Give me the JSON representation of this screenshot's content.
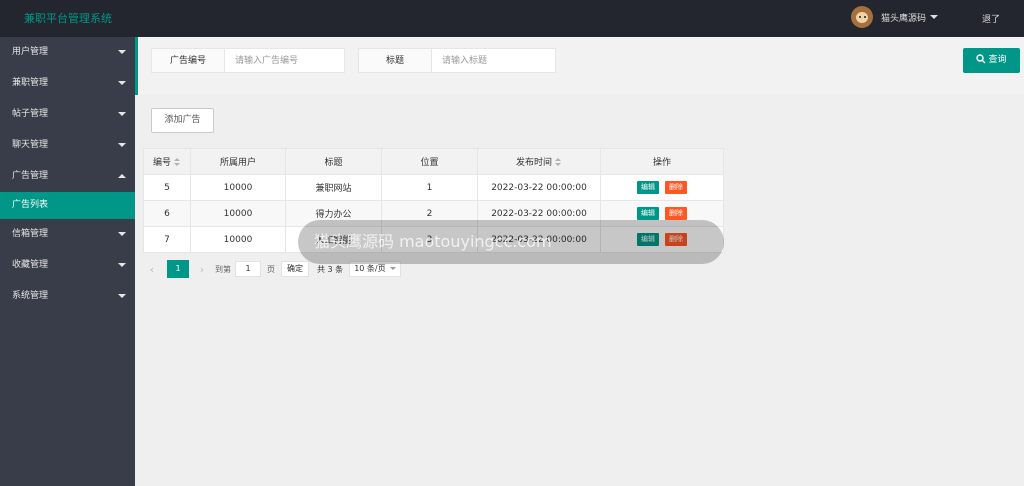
{
  "header": {
    "app_title": "兼职平台管理系统",
    "username": "猫头鹰源码",
    "logout": "退了"
  },
  "sidebar": {
    "items": [
      {
        "label": "用户管理",
        "expanded": false
      },
      {
        "label": "兼职管理",
        "expanded": false
      },
      {
        "label": "帖子管理",
        "expanded": false
      },
      {
        "label": "聊天管理",
        "expanded": false
      },
      {
        "label": "广告管理",
        "expanded": true,
        "sub": "广告列表"
      },
      {
        "label": "信箱管理",
        "expanded": false
      },
      {
        "label": "收藏管理",
        "expanded": false
      },
      {
        "label": "系统管理",
        "expanded": false
      }
    ]
  },
  "search": {
    "ad_id_label": "广告编号",
    "ad_id_placeholder": "请输入广告编号",
    "title_label": "标题",
    "title_placeholder": "请输入标题",
    "query_label": "查询"
  },
  "toolbar": {
    "add_label": "添加广告"
  },
  "table": {
    "headers": [
      "编号",
      "所属用户",
      "标题",
      "位置",
      "发布时间",
      "操作"
    ],
    "rows": [
      {
        "id": "5",
        "user": "10000",
        "title": "兼职网站",
        "position": "1",
        "time": "2022-03-22 00:00:00"
      },
      {
        "id": "6",
        "user": "10000",
        "title": "得力办公",
        "position": "2",
        "time": "2022-03-22 00:00:00"
      },
      {
        "id": "7",
        "user": "10000",
        "title": "人工智能",
        "position": "3",
        "time": "2022-03-22 00:00:00"
      }
    ],
    "edit_label": "编辑",
    "delete_label": "删除"
  },
  "pager": {
    "current": "1",
    "goto_prefix": "到第",
    "goto_value": "1",
    "page_suffix": "页",
    "confirm": "确定",
    "total": "共 3 条",
    "page_size": "10 条/页"
  },
  "toast": {
    "text": "猫头鹰源码 maotouyingcc.com"
  },
  "colors": {
    "accent": "#009688",
    "danger": "#ff5722",
    "sidebar": "#393d49",
    "header": "#23262e"
  }
}
